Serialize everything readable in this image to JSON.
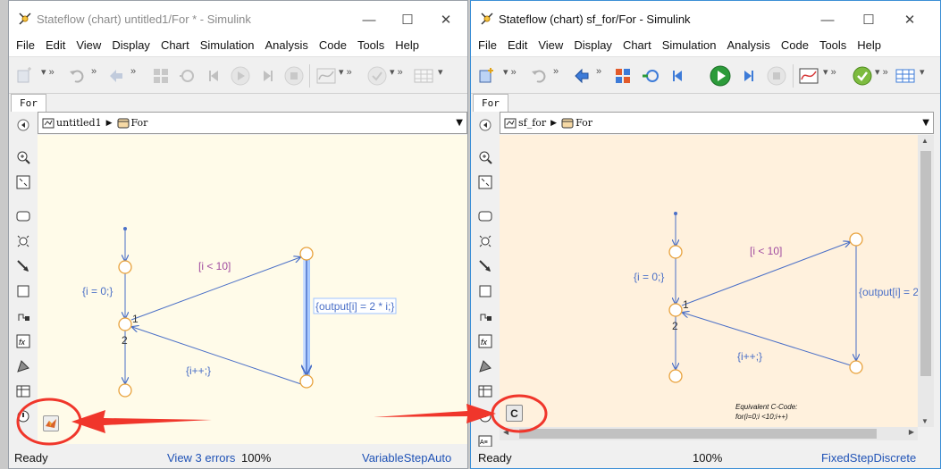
{
  "left_window": {
    "title": "Stateflow (chart) untitled1/For * - Simulink",
    "menu": [
      "File",
      "Edit",
      "View",
      "Display",
      "Chart",
      "Simulation",
      "Analysis",
      "Code",
      "Tools",
      "Help"
    ],
    "tab": "For",
    "breadcrumb": {
      "model": "untitled1",
      "chart": "For"
    },
    "diagram": {
      "cond_label": "[i < 10]",
      "init_label": "{i = 0;}",
      "action_label": "{output[i] = 2 * i;}",
      "incr_label": "{i++;}",
      "order_1": "1",
      "order_2": "2"
    },
    "status": {
      "left": "Ready",
      "middle": "View 3 errors",
      "zoom": "100%",
      "solver": "VariableStepAuto"
    }
  },
  "right_window": {
    "title": "Stateflow (chart) sf_for/For - Simulink",
    "menu": [
      "File",
      "Edit",
      "View",
      "Display",
      "Chart",
      "Simulation",
      "Analysis",
      "Code",
      "Tools",
      "Help"
    ],
    "tab": "For",
    "breadcrumb": {
      "model": "sf_for",
      "chart": "For"
    },
    "diagram": {
      "cond_label": "[i < 10]",
      "init_label": "{i = 0;}",
      "action_label": "{output[i] = 2",
      "incr_label": "{i++;}",
      "order_1": "1",
      "order_2": "2",
      "code_title": "Equivalent C-Code:",
      "code_line1": "for(i=0;i <10;i++)"
    },
    "code_button_label": "C",
    "status": {
      "left": "Ready",
      "zoom": "100%",
      "solver": "FixedStepDiscrete"
    }
  },
  "window_controls": {
    "minimize": "—",
    "maximize": "☐",
    "close": "✕"
  },
  "colors": {
    "annotation_red": "#f0362b",
    "junction": "#e8a23c",
    "transition": "#4a6fc7",
    "label": "#a04ba0",
    "action": "#4a6fc7"
  }
}
